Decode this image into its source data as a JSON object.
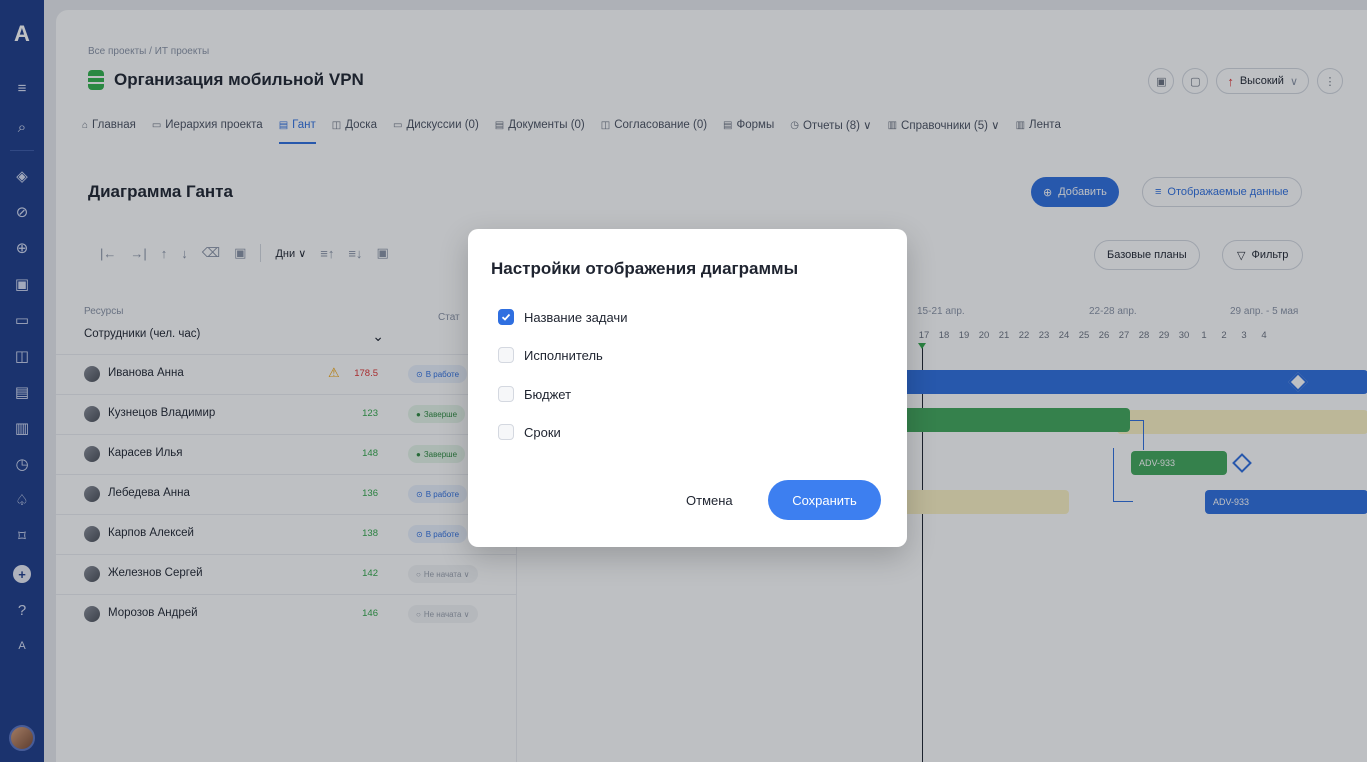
{
  "rail": {
    "logo": "A",
    "items": [
      {
        "name": "menu-icon",
        "glyph": "≡"
      },
      {
        "name": "search-icon",
        "glyph": "⌕"
      },
      {
        "name": "layers-icon",
        "glyph": "◈"
      },
      {
        "name": "check-circle-icon",
        "glyph": "⊘"
      },
      {
        "name": "arrow-circle-icon",
        "glyph": "⊕"
      },
      {
        "name": "calendar-icon",
        "glyph": "▣"
      },
      {
        "name": "chat-icon",
        "glyph": "▭"
      },
      {
        "name": "board-icon",
        "glyph": "◫"
      },
      {
        "name": "document-icon",
        "glyph": "▤"
      },
      {
        "name": "news-icon",
        "glyph": "▥"
      },
      {
        "name": "clock-icon",
        "glyph": "◷"
      },
      {
        "name": "bell-icon",
        "glyph": "♤"
      },
      {
        "name": "bookmark-icon",
        "glyph": "⌑"
      }
    ],
    "plus": "+",
    "help": "?",
    "profile_letter": "A"
  },
  "header": {
    "breadcrumb": "Все проекты / ИТ проекты",
    "title": "Организация мобильной VPN",
    "priority_label": "Высокий",
    "priority_arrow": "↑",
    "priority_chevron": "∨",
    "more_glyph": "⋮",
    "icon_btn_1": "▣",
    "icon_btn_2": "▢"
  },
  "tabs": [
    {
      "icon": "⌂",
      "label": "Главная"
    },
    {
      "icon": "▭",
      "label": "Иерархия проекта"
    },
    {
      "icon": "▤",
      "label": "Гант"
    },
    {
      "icon": "◫",
      "label": "Доска"
    },
    {
      "icon": "▭",
      "label": "Дискуссии (0)"
    },
    {
      "icon": "▤",
      "label": "Документы (0)"
    },
    {
      "icon": "◫",
      "label": "Согласование (0)"
    },
    {
      "icon": "▤",
      "label": "Формы"
    },
    {
      "icon": "◷",
      "label": "Отчеты (8) ∨"
    },
    {
      "icon": "▥",
      "label": "Справочники (5) ∨"
    },
    {
      "icon": "▥",
      "label": "Лента"
    }
  ],
  "section": {
    "title": "Диаграмма Ганта",
    "add_label": "Добавить",
    "add_icon": "⊕",
    "data_label": "Отображаемые данные",
    "data_icon": "≡",
    "baseline_label": "Базовые планы",
    "filter_label": "Фильтр",
    "filter_icon": "▽"
  },
  "toolbar": {
    "icons": [
      "|←",
      "→|",
      "↑",
      "↓",
      "⌫",
      "▣"
    ],
    "days_label": "Дни ∨",
    "icons2": [
      "≡↑",
      "≡↓",
      "▣"
    ]
  },
  "resources": {
    "header": "Ресурсы",
    "selector": "Сотрудники (чел. час)",
    "status_header": "Стат",
    "rows": [
      {
        "name": "Иванова Анна",
        "hours": "178.5",
        "warn": true,
        "status": "В работе",
        "status_type": "work",
        "status_icon": "⊙"
      },
      {
        "name": "Кузнецов Владимир",
        "hours": "123",
        "warn": false,
        "status": "Заверше",
        "status_type": "done",
        "status_icon": "●"
      },
      {
        "name": "Карасев Илья",
        "hours": "148",
        "warn": false,
        "status": "Заверше",
        "status_type": "done",
        "status_icon": "●"
      },
      {
        "name": "Лебедева Анна",
        "hours": "136",
        "warn": false,
        "status": "В работе",
        "status_type": "work",
        "status_icon": "⊙"
      },
      {
        "name": "Карпов Алексей",
        "hours": "138",
        "warn": false,
        "status": "В работе",
        "status_type": "work",
        "status_icon": "⊙"
      },
      {
        "name": "Железнов Сергей",
        "hours": "142",
        "warn": false,
        "status": "Не начата ∨",
        "status_type": "new",
        "status_icon": "○"
      },
      {
        "name": "Морозов Андрей",
        "hours": "146",
        "warn": false,
        "status": "Не начата ∨",
        "status_type": "new",
        "status_icon": "○"
      }
    ]
  },
  "gantt": {
    "weeks": [
      "15-21 апр.",
      "22-28 апр.",
      "29 апр. - 5 мая"
    ],
    "days": [
      "17",
      "18",
      "19",
      "20",
      "21",
      "22",
      "23",
      "24",
      "25",
      "26",
      "27",
      "28",
      "29",
      "30",
      "1",
      "2",
      "3",
      "4"
    ],
    "task_label": "ADV-933",
    "task_label_2": "ADV-933"
  },
  "modal": {
    "title": "Настройки отображения диаграммы",
    "options": [
      {
        "label": "Название задачи",
        "checked": true
      },
      {
        "label": "Исполнитель",
        "checked": false
      },
      {
        "label": "Бюджет",
        "checked": false
      },
      {
        "label": "Сроки",
        "checked": false
      }
    ],
    "cancel_label": "Отмена",
    "save_label": "Сохранить"
  },
  "colors": {
    "rail": "#1e3c8a",
    "accent": "#2f6fe0",
    "save": "#3d7ff0",
    "done": "#42a85a",
    "warning": "#e03131"
  }
}
